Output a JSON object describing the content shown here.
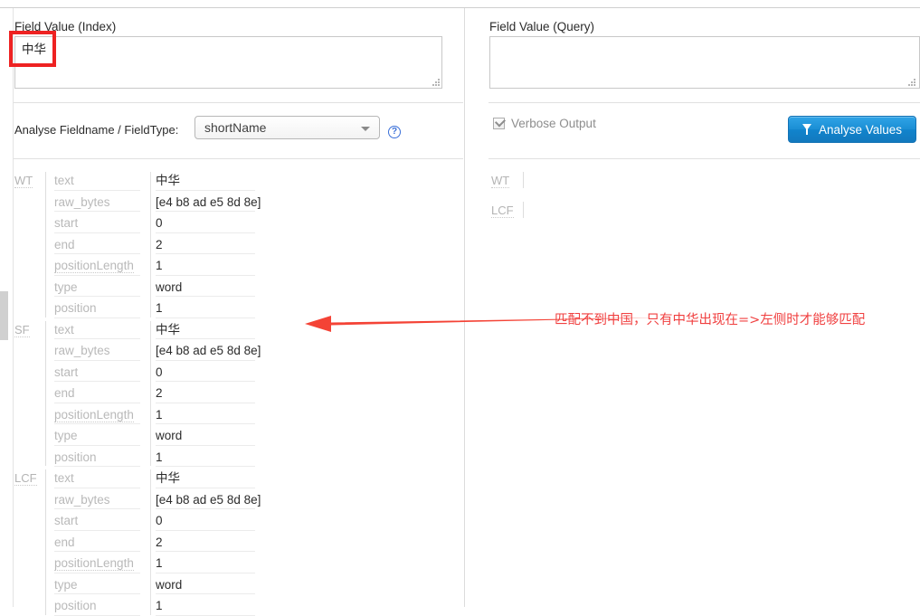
{
  "panels": {
    "index": {
      "label": "Field Value (Index)",
      "value": "中华",
      "placeholder": ""
    },
    "query": {
      "label": "Field Value (Query)",
      "value": "",
      "placeholder": ""
    }
  },
  "controls": {
    "analyse_label": "Analyse Fieldname / FieldType:",
    "field_select_value": "shortName",
    "help_icon_glyph": "?",
    "help_icon_name": "question-mark-icon",
    "verbose_label": "Verbose Output",
    "verbose_checked": true,
    "analyse_button_label": "Analyse Values",
    "analyse_button_icon": "filter-funnel-icon"
  },
  "colors": {
    "accent_blue": "#2fa4e7",
    "annotation_red": "#f04040",
    "highlight_red": "#ee2222",
    "muted_grey": "#b9b9b9"
  },
  "results": {
    "index_groups": [
      {
        "name": "WT",
        "rows": [
          {
            "key": "text",
            "value": "中华",
            "dotted": false
          },
          {
            "key": "raw_bytes",
            "value": "[e4 b8 ad e5 8d 8e]",
            "dotted": false
          },
          {
            "key": "start",
            "value": "0",
            "dotted": false
          },
          {
            "key": "end",
            "value": "2",
            "dotted": false
          },
          {
            "key": "positionLength",
            "value": "1",
            "dotted": true
          },
          {
            "key": "type",
            "value": "word",
            "dotted": false
          },
          {
            "key": "position",
            "value": "1",
            "dotted": false
          }
        ]
      },
      {
        "name": "SF",
        "rows": [
          {
            "key": "text",
            "value": "中华",
            "dotted": false
          },
          {
            "key": "raw_bytes",
            "value": "[e4 b8 ad e5 8d 8e]",
            "dotted": false
          },
          {
            "key": "start",
            "value": "0",
            "dotted": false
          },
          {
            "key": "end",
            "value": "2",
            "dotted": false
          },
          {
            "key": "positionLength",
            "value": "1",
            "dotted": true
          },
          {
            "key": "type",
            "value": "word",
            "dotted": false
          },
          {
            "key": "position",
            "value": "1",
            "dotted": false
          }
        ]
      },
      {
        "name": "LCF",
        "rows": [
          {
            "key": "text",
            "value": "中华",
            "dotted": false
          },
          {
            "key": "raw_bytes",
            "value": "[e4 b8 ad e5 8d 8e]",
            "dotted": false
          },
          {
            "key": "start",
            "value": "0",
            "dotted": false
          },
          {
            "key": "end",
            "value": "2",
            "dotted": false
          },
          {
            "key": "positionLength",
            "value": "1",
            "dotted": true
          },
          {
            "key": "type",
            "value": "word",
            "dotted": false
          },
          {
            "key": "position",
            "value": "1",
            "dotted": false
          }
        ]
      }
    ],
    "query_groups": [
      {
        "name": "WT",
        "rows": []
      },
      {
        "name": "LCF",
        "rows": []
      }
    ]
  },
  "annotation": {
    "text": "匹配不到中国，只有中华出现在=>左侧时才能够匹配",
    "arrow_name": "red-left-arrow"
  }
}
